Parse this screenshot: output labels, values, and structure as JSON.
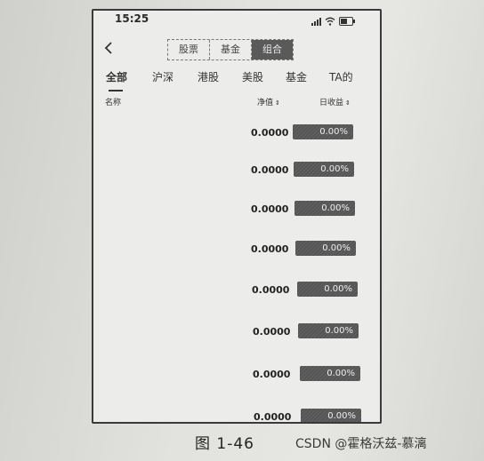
{
  "status_bar": {
    "time": "15:25"
  },
  "header": {
    "back_icon": "chevron-left-icon",
    "segments": [
      {
        "label": "股票",
        "active": false
      },
      {
        "label": "基金",
        "active": false
      },
      {
        "label": "组合",
        "active": true
      }
    ]
  },
  "tabs": [
    {
      "label": "全部",
      "active": true
    },
    {
      "label": "沪深",
      "active": false
    },
    {
      "label": "港股",
      "active": false
    },
    {
      "label": "美股",
      "active": false
    },
    {
      "label": "基金",
      "active": false
    },
    {
      "label": "TA的",
      "active": false
    }
  ],
  "columns": {
    "name": "名称",
    "nav": "净值",
    "yield": "日收益"
  },
  "rows": [
    {
      "nav": "0.0000",
      "yield": "0.00%"
    },
    {
      "nav": "0.0000",
      "yield": "0.00%"
    },
    {
      "nav": "0.0000",
      "yield": "0.00%"
    },
    {
      "nav": "0.0000",
      "yield": "0.00%"
    },
    {
      "nav": "0.0000",
      "yield": "0.00%"
    },
    {
      "nav": "0.0000",
      "yield": "0.00%"
    },
    {
      "nav": "0.0000",
      "yield": "0.00%"
    },
    {
      "nav": "0.0000",
      "yield": "0.00%"
    }
  ],
  "caption": "图 1-46",
  "watermark": "CSDN @霍格沃兹-慕漓"
}
